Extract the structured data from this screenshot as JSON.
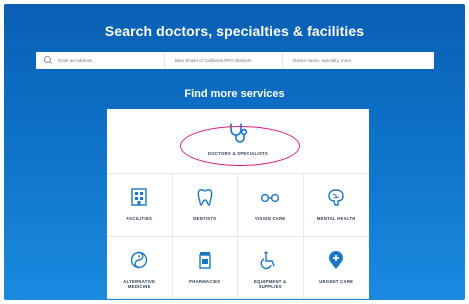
{
  "hero": {
    "title": "Search doctors, specialties & facilities",
    "subtitle": "Find more services"
  },
  "search": {
    "address_placeholder": "Enter an address",
    "network_value": "Blue Shield of California PPO Network",
    "doctor_placeholder": "Doctor name, specialty, more"
  },
  "services": {
    "featured": {
      "label": "DOCTORS & SPECIALISTS",
      "icon": "stethoscope-icon"
    },
    "tiles": [
      {
        "label": "FACILITIES",
        "icon": "building-icon"
      },
      {
        "label": "DENTISTS",
        "icon": "tooth-icon"
      },
      {
        "label": "VISION CARE",
        "icon": "glasses-icon"
      },
      {
        "label": "MENTAL HEALTH",
        "icon": "brain-icon"
      },
      {
        "label": "ALTERNATIVE MEDICINE",
        "icon": "yin-yang-icon"
      },
      {
        "label": "PHARMACIES",
        "icon": "pill-bottle-icon"
      },
      {
        "label": "EQUIPMENT & SUPPLIES",
        "icon": "wheelchair-icon"
      },
      {
        "label": "URGENT CARE",
        "icon": "urgent-care-pin-icon"
      }
    ]
  },
  "colors": {
    "accent": "#0d72c8",
    "icon_blue": "#1877c9",
    "highlight": "#d11f7a"
  }
}
